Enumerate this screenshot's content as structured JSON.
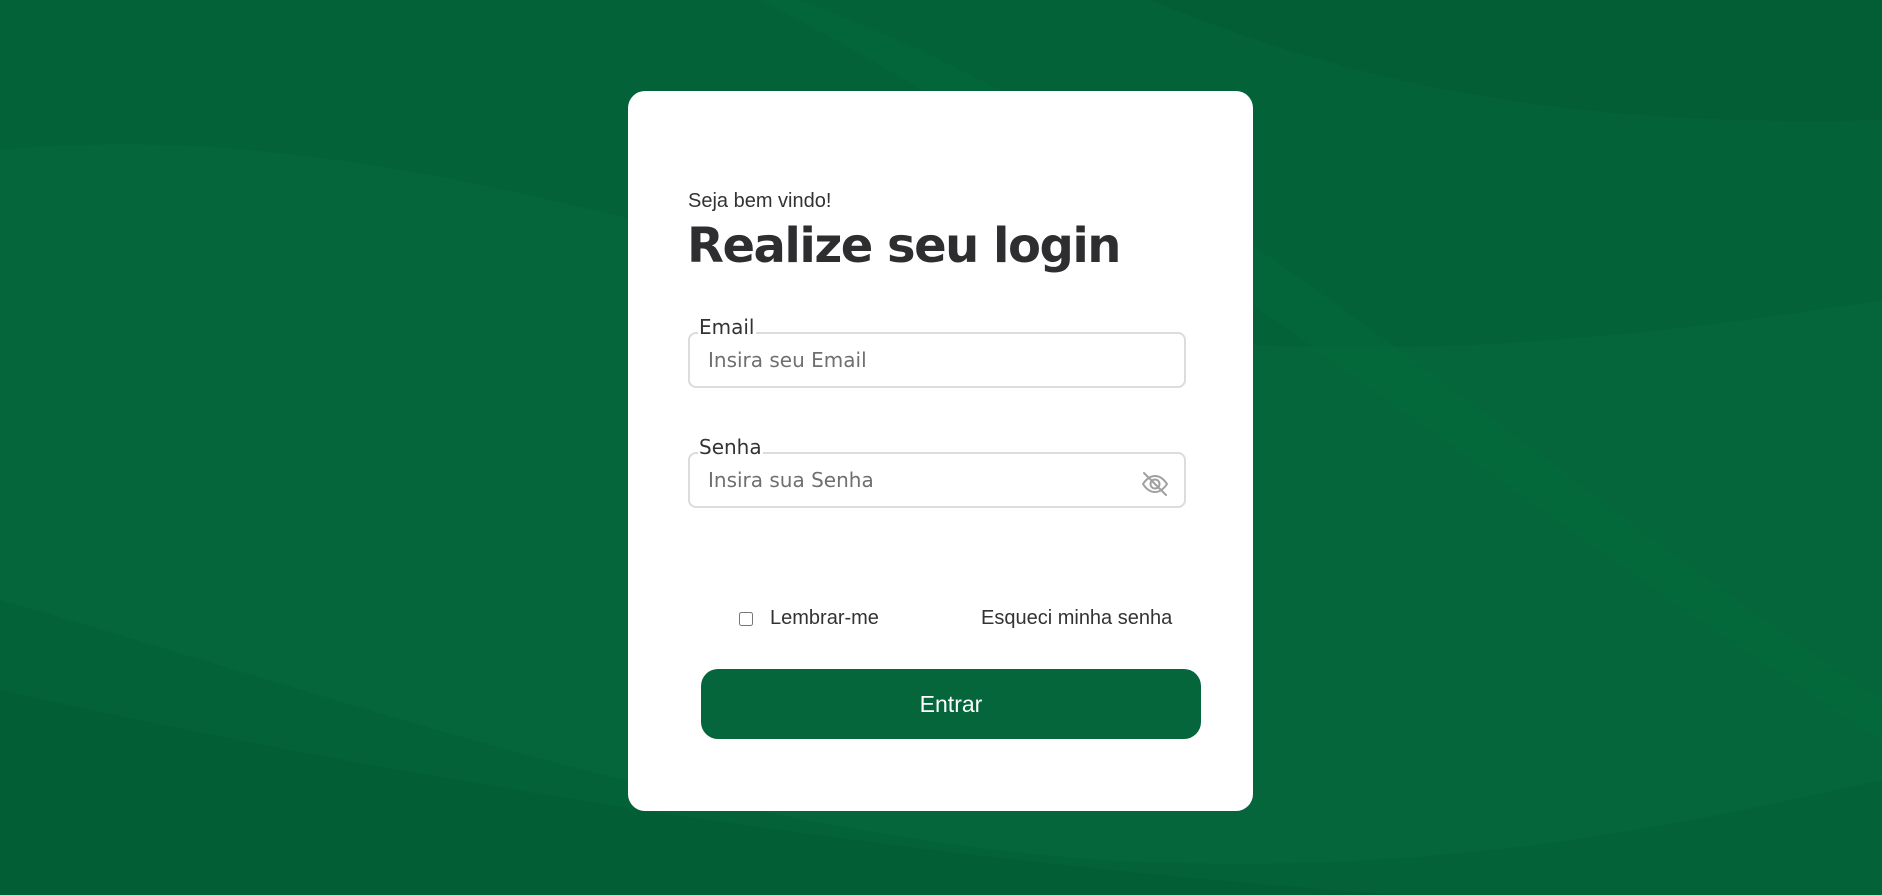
{
  "colors": {
    "background": "#04663a",
    "card": "#ffffff",
    "button": "#04663a",
    "title": "#2e2e30",
    "text": "#333333",
    "input_border": "#dcdcdc"
  },
  "login": {
    "greeting": "Seja bem vindo!",
    "title": "Realize seu login",
    "email": {
      "label": "Email",
      "placeholder": "Insira seu Email",
      "value": ""
    },
    "password": {
      "label": "Senha",
      "placeholder": "Insira sua Senha",
      "value": "",
      "toggle_icon": "eye-slash-icon"
    },
    "remember_me": {
      "label": "Lembrar-me",
      "checked": false
    },
    "forgot_password": "Esqueci minha senha",
    "submit_label": "Entrar"
  }
}
